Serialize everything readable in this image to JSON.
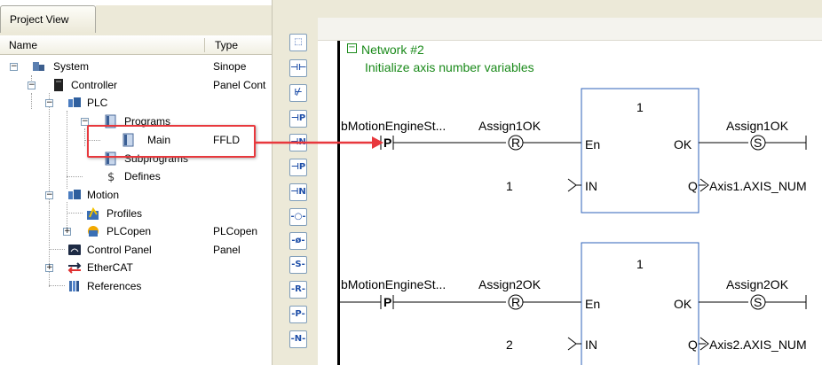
{
  "project_view": {
    "tab_label": "Project View",
    "columns": {
      "name": "Name",
      "type": "Type"
    },
    "tree": [
      {
        "label": "System",
        "type": "Sinope",
        "icon": "system-icon"
      },
      {
        "label": "Controller",
        "type": "Panel Cont",
        "icon": "controller-icon"
      },
      {
        "label": "PLC",
        "type": "",
        "icon": "plc-icon"
      },
      {
        "label": "Programs",
        "type": "",
        "icon": "programs-icon"
      },
      {
        "label": "Main",
        "type": "FFLD",
        "icon": "program-main-icon"
      },
      {
        "label": "Subprograms",
        "type": "",
        "icon": "subprograms-icon"
      },
      {
        "label": "Defines",
        "type": "",
        "icon": "defines-icon"
      },
      {
        "label": "Motion",
        "type": "",
        "icon": "motion-icon"
      },
      {
        "label": "Profiles",
        "type": "",
        "icon": "profiles-icon"
      },
      {
        "label": "PLCopen",
        "type": "PLCopen",
        "icon": "plcopen-icon"
      },
      {
        "label": "Control Panel",
        "type": "Panel",
        "icon": "control-panel-icon"
      },
      {
        "label": "EtherCAT",
        "type": "",
        "icon": "ethercat-icon"
      },
      {
        "label": "References",
        "type": "",
        "icon": "references-icon"
      }
    ],
    "expanders": {
      "collapse": "−",
      "expand": "+"
    }
  },
  "toolbar": {
    "buttons": [
      {
        "name": "select-tool-button",
        "glyph": "⬚"
      },
      {
        "name": "contact-button",
        "glyph": "⊣⊢"
      },
      {
        "name": "negated-contact-button",
        "glyph": "⊬"
      },
      {
        "name": "positive-pulse-contact-button",
        "glyph": "⊣P"
      },
      {
        "name": "negative-pulse-contact-button",
        "glyph": "⊣N"
      },
      {
        "name": "contact-variant-button",
        "glyph": "⊣P"
      },
      {
        "name": "contact-variant2-button",
        "glyph": "⊣N"
      },
      {
        "name": "coil-button",
        "glyph": "-○-"
      },
      {
        "name": "negated-coil-button",
        "glyph": "-ø-"
      },
      {
        "name": "set-coil-button",
        "glyph": "-S-"
      },
      {
        "name": "reset-coil-button",
        "glyph": "-R-"
      },
      {
        "name": "pulse-coil-button",
        "glyph": "-P-"
      },
      {
        "name": "negative-pulse-coil-button",
        "glyph": "-N-"
      }
    ]
  },
  "editor": {
    "network_toggle": "−",
    "network_title": "Network #2",
    "network_comment": "Initialize axis number variables",
    "rungs": [
      {
        "input_var": "bMotionEngineSt...",
        "contact_type": "P",
        "assign_var": "Assign1OK",
        "reset_coil": "R",
        "block_number": "1",
        "block_pin_en": "En",
        "block_pin_ok": "OK",
        "block_pin_in": "IN",
        "block_pin_q": "Q",
        "input_value": "1",
        "output_var": "Assign1OK",
        "set_coil": "S",
        "q_target": "Axis1.AXIS_NUM"
      },
      {
        "input_var": "bMotionEngineSt...",
        "contact_type": "P",
        "assign_var": "Assign2OK",
        "reset_coil": "R",
        "block_number": "1",
        "block_pin_en": "En",
        "block_pin_ok": "OK",
        "block_pin_in": "IN",
        "block_pin_q": "Q",
        "input_value": "2",
        "output_var": "Assign2OK",
        "set_coil": "S",
        "q_target": "Axis2.AXIS_NUM"
      }
    ]
  },
  "colors": {
    "annotation_red": "#e8383d",
    "network_green": "#1a8a1a",
    "toolbar_blue": "#1f4fa8"
  }
}
